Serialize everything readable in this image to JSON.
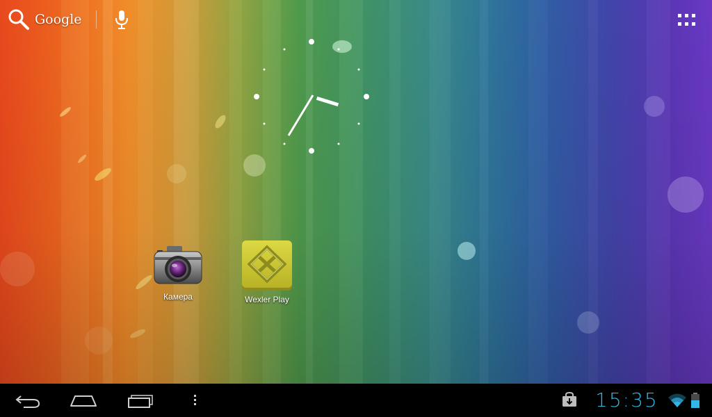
{
  "search": {
    "label": "Google"
  },
  "shortcuts": [
    {
      "label": "Камера"
    },
    {
      "label": "Wexler Play"
    }
  ],
  "status": {
    "time": "15:35"
  },
  "colors": {
    "accent": "#33b5e5",
    "wexler_yellow": "#c9c633",
    "navbar": "#000000"
  },
  "icons": {
    "search": "search-icon",
    "voice": "microphone-icon",
    "apps": "apps-grid-icon",
    "back": "back-icon",
    "home": "home-icon",
    "recent": "recent-apps-icon",
    "menu": "menu-icon",
    "notification": "shopping-bag-icon",
    "wifi": "wifi-icon",
    "battery": "battery-icon"
  }
}
